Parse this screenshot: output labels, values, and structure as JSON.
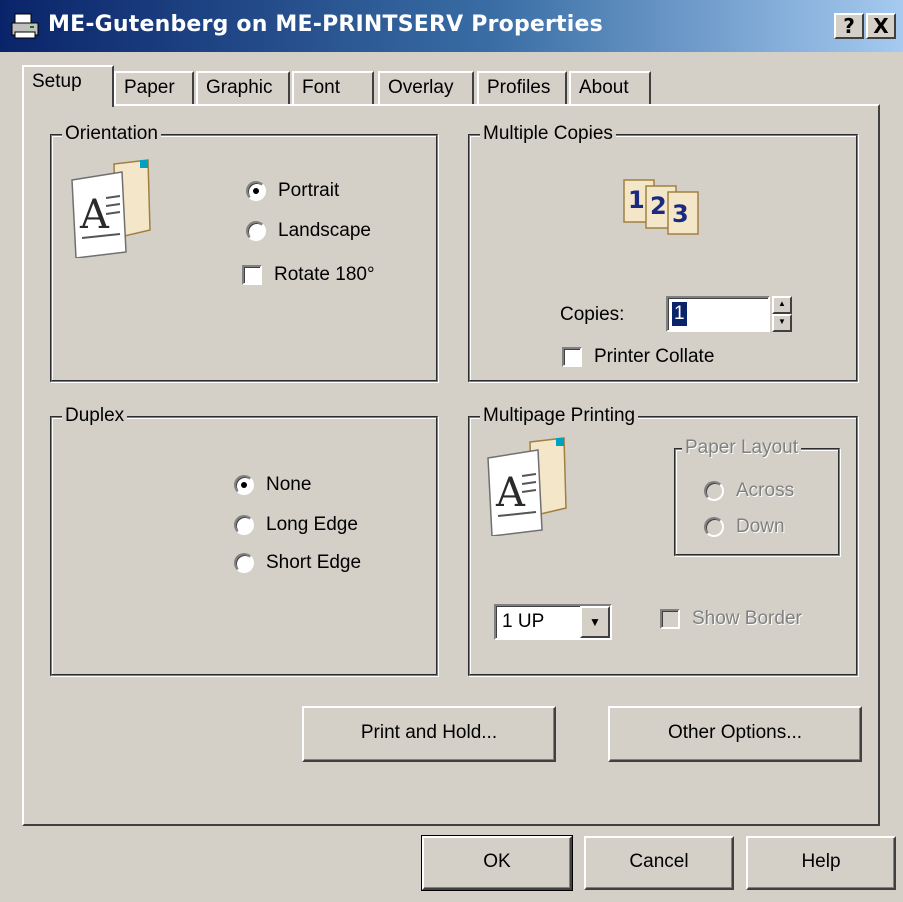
{
  "window": {
    "title": "ME-Gutenberg on ME-PRINTSERV Properties",
    "help_btn": "?",
    "close_btn": "X"
  },
  "tabs": [
    "Setup",
    "Paper",
    "Graphic",
    "Font",
    "Overlay",
    "Profiles",
    "About"
  ],
  "orientation": {
    "label": "Orientation",
    "portrait": "Portrait",
    "landscape": "Landscape",
    "rotate": "Rotate 180°",
    "selected": "Portrait"
  },
  "copies": {
    "label": "Multiple Copies",
    "copies_label": "Copies:",
    "copies_value": "1",
    "collate": "Printer Collate",
    "icon_digits": [
      "1",
      "2",
      "3"
    ]
  },
  "duplex": {
    "label": "Duplex",
    "none": "None",
    "long": "Long Edge",
    "short": "Short Edge",
    "selected": "None"
  },
  "multipage": {
    "label": "Multipage Printing",
    "layout_label": "Paper Layout",
    "across": "Across",
    "down": "Down",
    "up_select": "1 UP",
    "show_border": "Show Border"
  },
  "actions": {
    "print_hold": "Print and Hold...",
    "other_options": "Other Options..."
  },
  "footer": {
    "ok": "OK",
    "cancel": "Cancel",
    "help": "Help"
  }
}
